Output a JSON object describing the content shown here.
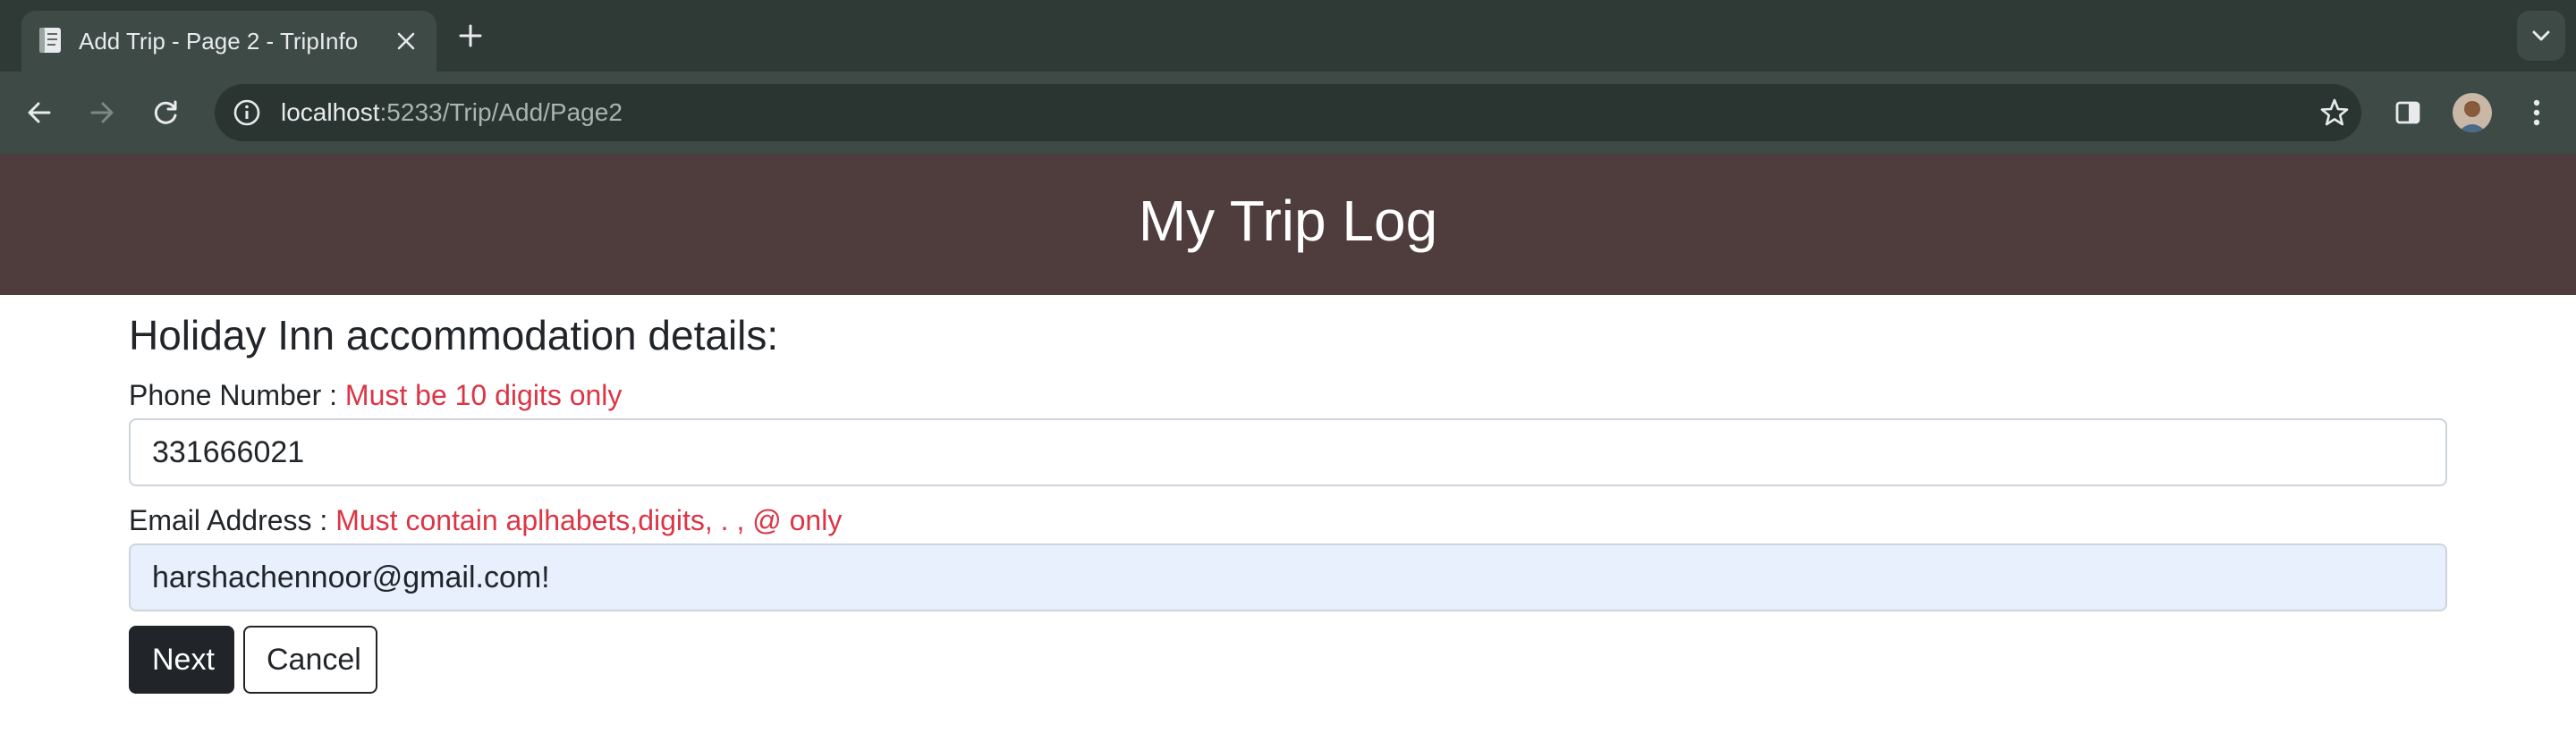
{
  "browser": {
    "tab": {
      "title": "Add Trip - Page 2 - TripInfo",
      "favicon": "document-icon"
    },
    "url": {
      "host": "localhost",
      "path": ":5233/Trip/Add/Page2"
    },
    "icons": {
      "back": "arrow-left-icon",
      "forward": "arrow-right-icon",
      "reload": "reload-icon",
      "site_info": "info-icon",
      "bookmark": "star-icon",
      "side_panel": "side-panel-icon",
      "profile": "avatar",
      "menu": "kebab-menu-icon",
      "tab_search": "chevron-down-icon",
      "new_tab": "plus-icon",
      "close_tab": "close-icon"
    }
  },
  "app": {
    "title": "My Trip Log",
    "header_color": "#4f3d3d"
  },
  "form": {
    "heading": "Holiday Inn accommodation details:",
    "phone": {
      "label": "Phone Number :",
      "error": "Must be 10 digits only",
      "value": "331666021"
    },
    "email": {
      "label": "Email Address :",
      "error": "Must contain aplhabets,digits, . , @ only",
      "value": "harshachennoor@gmail.com!"
    },
    "buttons": {
      "next": "Next",
      "cancel": "Cancel"
    },
    "error_color": "#dc3545"
  }
}
